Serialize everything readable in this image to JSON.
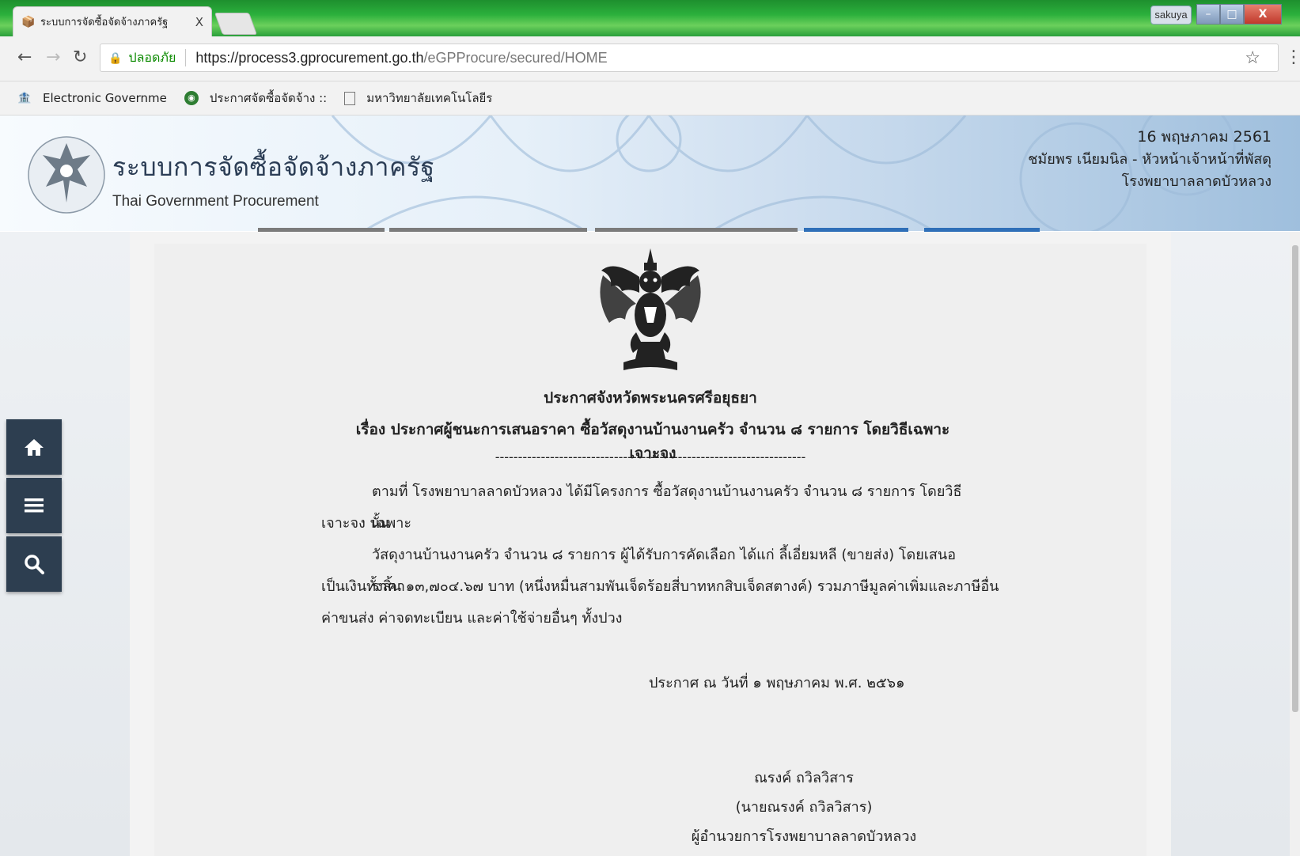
{
  "browser": {
    "tab_title": "ระบบการจัดซื้อจัดจ้างภาครัฐ",
    "tab_close": "X",
    "user_badge": "sakuya",
    "window_close": "X",
    "secure_label": "ปลอดภัย",
    "url_main": "https://process3.gprocurement.go.th",
    "url_path": "/eGPProcure/secured/HOME",
    "bookmarks": [
      {
        "label": "Electronic Governme",
        "icon": "egp-icon"
      },
      {
        "label": "ประกาศจัดซื้อจัดจ้าง :: ",
        "icon": "globe-icon"
      },
      {
        "label": "มหาวิทยาลัยเทคโนโลยีร",
        "icon": "page-icon"
      }
    ]
  },
  "header": {
    "title": "ระบบการจัดซื้อจัดจ้างภาครัฐ",
    "subtitle": "Thai Government Procurement",
    "date": "16 พฤษภาคม 2561",
    "user": "ชมัยพร เนียมนิล - หัวหน้าเจ้าหน้าที่พัสดุ",
    "org": "โรงพยาบาลลาดบัวหลวง"
  },
  "sidebar": {
    "items": [
      {
        "name": "home",
        "icon": "home-icon"
      },
      {
        "name": "menu",
        "icon": "hamburger-icon"
      },
      {
        "name": "search",
        "icon": "search-icon"
      }
    ]
  },
  "announcement": {
    "heading": "ประกาศจังหวัดพระนครศรีอยุธยา",
    "subject_prefix": "เรื่อง ประกาศผู้ชนะการเสนอราคา",
    "subject_item": "ซื้อวัสดุงานบ้านงานครัว จำนวน ๘ รายการ โดยวิธีเฉพาะเจาะจง",
    "divider": "--------------------------------------------------------------------",
    "para1_line1": "ตามที่ โรงพยาบาลลาดบัวหลวง ได้มีโครงการ ซื้อวัสดุงานบ้านงานครัว จำนวน ๘ รายการ โดยวิธีเฉพาะ",
    "para1_line2": "เจาะจง  นั้น",
    "para2_line1": "วัสดุงานบ้านงานครัว จำนวน ๘ รายการ ผู้ได้รับการคัดเลือก ได้แก่ ลี้เอี่ยมหลี (ขายส่ง) โดยเสนอราคา",
    "para2_line2": "เป็นเงินทั้งสิ้น ๑๓,๗๐๔.๖๗ บาท (หนึ่งหมื่นสามพันเจ็ดร้อยสี่บาทหกสิบเจ็ดสตางค์) รวมภาษีมูลค่าเพิ่มและภาษีอื่น",
    "para2_line3": "ค่าขนส่ง ค่าจดทะเบียน และค่าใช้จ่ายอื่นๆ ทั้งปวง",
    "date_line": "ประกาศ ณ วันที่  ๑ พฤษภาคม พ.ศ. ๒๕๖๑",
    "signer_name": "ณรงค์ ถวิลวิสาร",
    "signer_full": "(นายณรงค์ ถวิลวิสาร)",
    "signer_title": "ผู้อำนวยการโรงพยาบาลลาดบัวหลวง"
  }
}
